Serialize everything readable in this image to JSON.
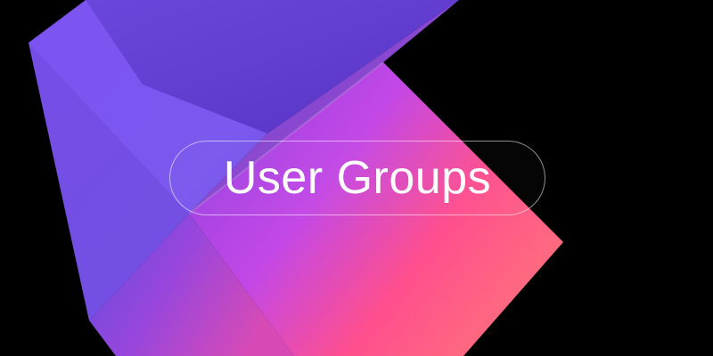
{
  "banner": {
    "title": "User Groups"
  },
  "colors": {
    "background": "#000000",
    "violet": "#7b4fee",
    "purple_dark": "#5a3bc4",
    "magenta": "#c348e6",
    "pink": "#ff5a8a",
    "text": "#ffffff"
  }
}
